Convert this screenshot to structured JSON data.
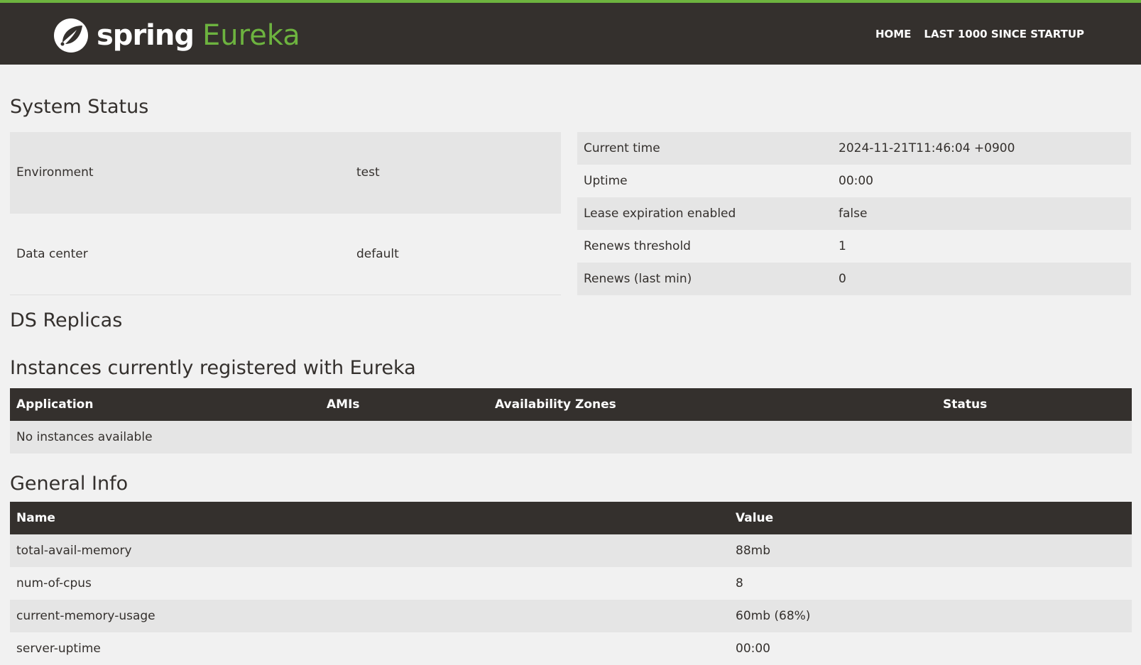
{
  "colors": {
    "accent": "#6db33f",
    "header_bg": "#34302d",
    "page_bg": "#f1f1f1",
    "row_alt": "#e5e5e5"
  },
  "brand": {
    "spring": "spring",
    "eureka": "Eureka",
    "logo_icon": "spring-leaf-icon"
  },
  "nav": {
    "home": "HOME",
    "last1000": "LAST 1000 SINCE STARTUP"
  },
  "system_status": {
    "title": "System Status",
    "left": [
      {
        "label": "Environment",
        "value": "test"
      },
      {
        "label": "Data center",
        "value": "default"
      }
    ],
    "right": [
      {
        "label": "Current time",
        "value": "2024-11-21T11:46:04 +0900"
      },
      {
        "label": "Uptime",
        "value": "00:00"
      },
      {
        "label": "Lease expiration enabled",
        "value": "false"
      },
      {
        "label": "Renews threshold",
        "value": "1"
      },
      {
        "label": "Renews (last min)",
        "value": "0"
      }
    ]
  },
  "ds_replicas": {
    "title": "DS Replicas"
  },
  "instances": {
    "title": "Instances currently registered with Eureka",
    "headers": [
      "Application",
      "AMIs",
      "Availability Zones",
      "Status"
    ],
    "empty_text": "No instances available"
  },
  "general_info": {
    "title": "General Info",
    "headers": [
      "Name",
      "Value"
    ],
    "rows": [
      {
        "name": "total-avail-memory",
        "value": "88mb"
      },
      {
        "name": "num-of-cpus",
        "value": "8"
      },
      {
        "name": "current-memory-usage",
        "value": "60mb (68%)"
      },
      {
        "name": "server-uptime",
        "value": "00:00"
      }
    ]
  }
}
